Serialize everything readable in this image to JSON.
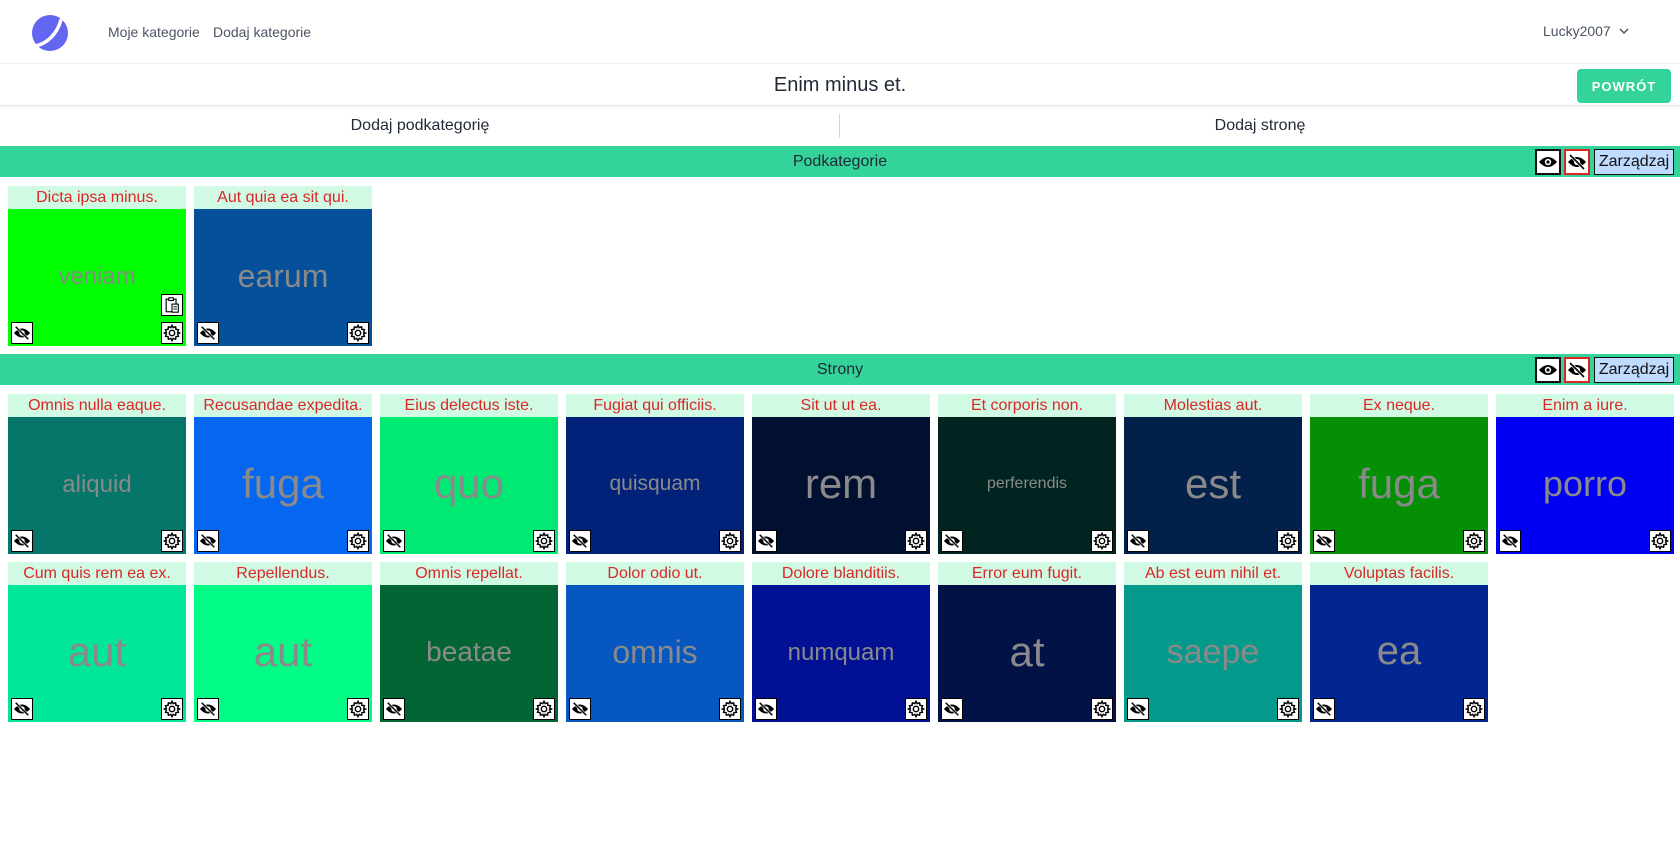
{
  "nav": {
    "links": [
      "Moje kategorie",
      "Dodaj kategorie"
    ],
    "user": "Lucky2007"
  },
  "header": {
    "title": "Enim minus et.",
    "back_label": "POWRÓT"
  },
  "actions": {
    "add_subcategory": "Dodaj podkategorię",
    "add_page": "Dodaj stronę"
  },
  "colors": {
    "accent": "#34d399",
    "card_title_bg": "#d1fae5",
    "card_title_text": "#dc2626",
    "manage_bg": "#bfdbfe"
  },
  "subcategories": {
    "title": "Podkategorie",
    "manage_label": "Zarządzaj",
    "items": [
      {
        "title": "Dicta ipsa minus.",
        "word": "veniam",
        "bg": "#00ff00",
        "size": 24,
        "clipboard": true
      },
      {
        "title": "Aut quia ea sit qui.",
        "word": "earum",
        "bg": "#064f9a",
        "size": 32
      }
    ]
  },
  "pages": {
    "title": "Strony",
    "manage_label": "Zarządzaj",
    "items": [
      {
        "title": "Omnis nulla eaque.",
        "word": "aliquid",
        "bg": "#06756a",
        "size": 24
      },
      {
        "title": "Recusandae expedita.",
        "word": "fuga",
        "bg": "#0566f0",
        "size": 42
      },
      {
        "title": "Eius delectus iste.",
        "word": "quo",
        "bg": "#00ea73",
        "size": 42
      },
      {
        "title": "Fugiat qui officiis.",
        "word": "quisquam",
        "bg": "#012278",
        "size": 21
      },
      {
        "title": "Sit ut ut ea.",
        "word": "rem",
        "bg": "#010f30",
        "size": 42
      },
      {
        "title": "Et corporis non.",
        "word": "perferendis",
        "bg": "#012421",
        "size": 16
      },
      {
        "title": "Molestias aut.",
        "word": "est",
        "bg": "#022049",
        "size": 42
      },
      {
        "title": "Ex neque.",
        "word": "fuga",
        "bg": "#048f04",
        "size": 42
      },
      {
        "title": "Enim a iure.",
        "word": "porro",
        "bg": "#0000f5",
        "size": 36
      },
      {
        "title": "Cum quis rem ea ex.",
        "word": "aut",
        "bg": "#00e79a",
        "size": 42
      },
      {
        "title": "Repellendus.",
        "word": "aut",
        "bg": "#02fc86",
        "size": 42
      },
      {
        "title": "Omnis repellat.",
        "word": "beatae",
        "bg": "#036533",
        "size": 28
      },
      {
        "title": "Dolor odio ut.",
        "word": "omnis",
        "bg": "#0657c0",
        "size": 32
      },
      {
        "title": "Dolore blanditiis.",
        "word": "numquam",
        "bg": "#021093",
        "size": 24
      },
      {
        "title": "Error eum fugit.",
        "word": "at",
        "bg": "#021246",
        "size": 42
      },
      {
        "title": "Ab est eum nihil et.",
        "word": "saepe",
        "bg": "#039a8c",
        "size": 34
      },
      {
        "title": "Voluptas facilis.",
        "word": "ea",
        "bg": "#032590",
        "size": 40
      }
    ]
  }
}
